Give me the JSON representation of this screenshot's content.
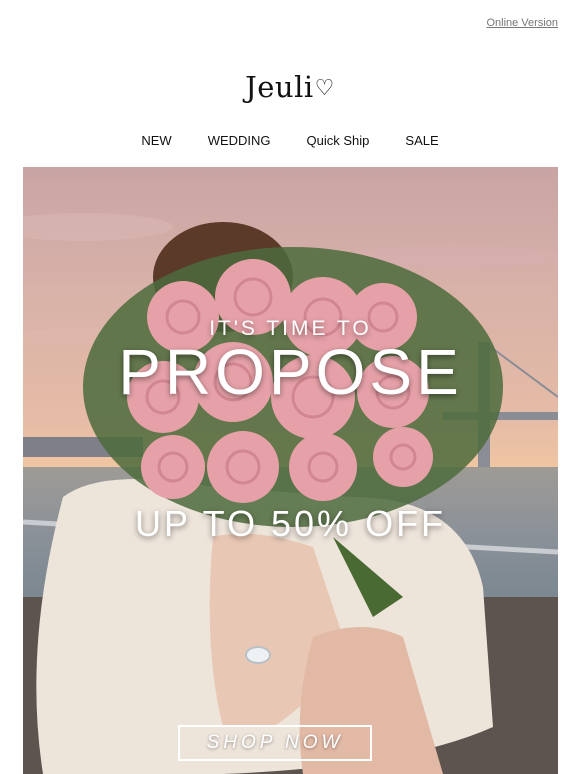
{
  "header": {
    "online_version": "Online Version",
    "logo_text": "Jeuli",
    "logo_mark_icon": "heart-icon"
  },
  "nav": {
    "items": [
      "NEW",
      "WEDDING",
      "Quick Ship",
      "SALE"
    ]
  },
  "hero": {
    "line1": "IT'S TIME TO",
    "line2": "PROPOSE",
    "line3": "UP TO 50% OFF",
    "cta": "SHOP NOW"
  },
  "colors": {
    "text": "#111111",
    "link": "#777777",
    "hero_text": "#ffffff",
    "rose": "#e8a2a8"
  }
}
